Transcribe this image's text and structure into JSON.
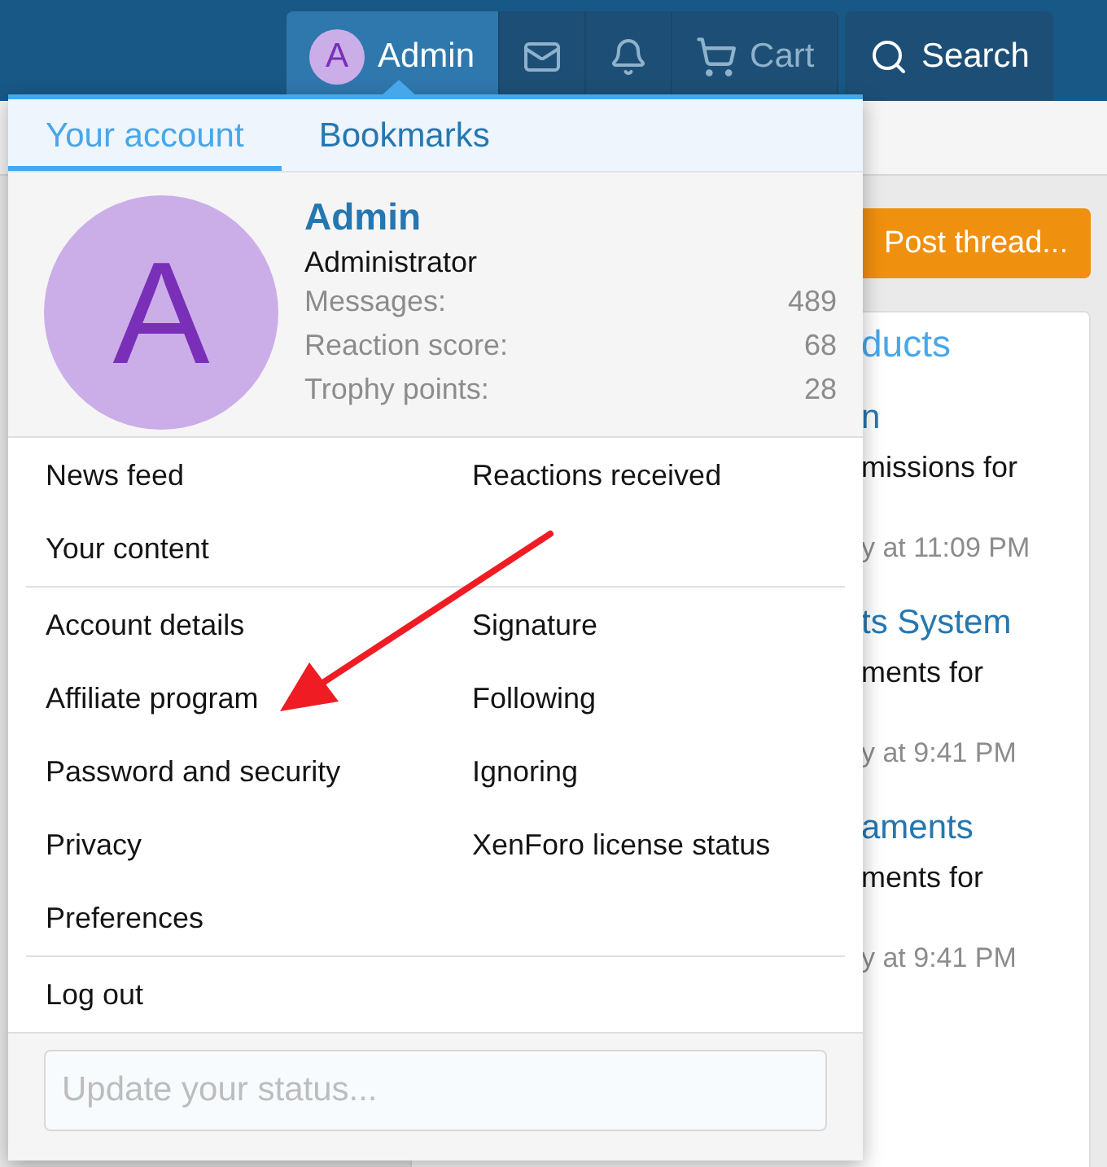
{
  "header": {
    "nav": [
      {
        "kind": "account",
        "label": "Admin",
        "avatar_letter": "A",
        "selected": true
      },
      {
        "kind": "inbox",
        "selected": false
      },
      {
        "kind": "alerts",
        "selected": false
      },
      {
        "kind": "cart",
        "label": "Cart",
        "selected": false
      }
    ],
    "search": {
      "label": "Search"
    }
  },
  "page": {
    "post_button": "Post thread...",
    "card_fragments": [
      {
        "kind": "title",
        "text": "ducts"
      },
      {
        "kind": "link",
        "text": "n"
      },
      {
        "kind": "text",
        "text": "missions for"
      },
      {
        "kind": "meta",
        "text": "y at 11:09 PM"
      },
      {
        "kind": "link",
        "text": "ts System"
      },
      {
        "kind": "text",
        "text": "ments for"
      },
      {
        "kind": "meta",
        "text": "y at 9:41 PM"
      },
      {
        "kind": "link",
        "text": "aments"
      },
      {
        "kind": "text",
        "text": "ments for"
      },
      {
        "kind": "meta",
        "text": "y at 9:41 PM"
      }
    ]
  },
  "account_menu": {
    "tabs": [
      {
        "label": "Your account",
        "selected": true
      },
      {
        "label": "Bookmarks",
        "selected": false
      }
    ],
    "profile": {
      "avatar_letter": "A",
      "name": "Admin",
      "title": "Administrator",
      "stats": [
        {
          "label": "Messages:",
          "value": "489"
        },
        {
          "label": "Reaction score:",
          "value": "68"
        },
        {
          "label": "Trophy points:",
          "value": "28"
        }
      ]
    },
    "sections": [
      {
        "left": [
          "News feed",
          "Your content"
        ],
        "right": [
          "Reactions received"
        ]
      },
      {
        "left": [
          "Account details",
          "Affiliate program",
          "Password and security",
          "Privacy",
          "Preferences"
        ],
        "right": [
          "Signature",
          "Following",
          "Ignoring",
          "XenForo license status"
        ]
      },
      {
        "left": [
          "Log out"
        ]
      }
    ],
    "status": {
      "placeholder": "Update your status..."
    }
  }
}
